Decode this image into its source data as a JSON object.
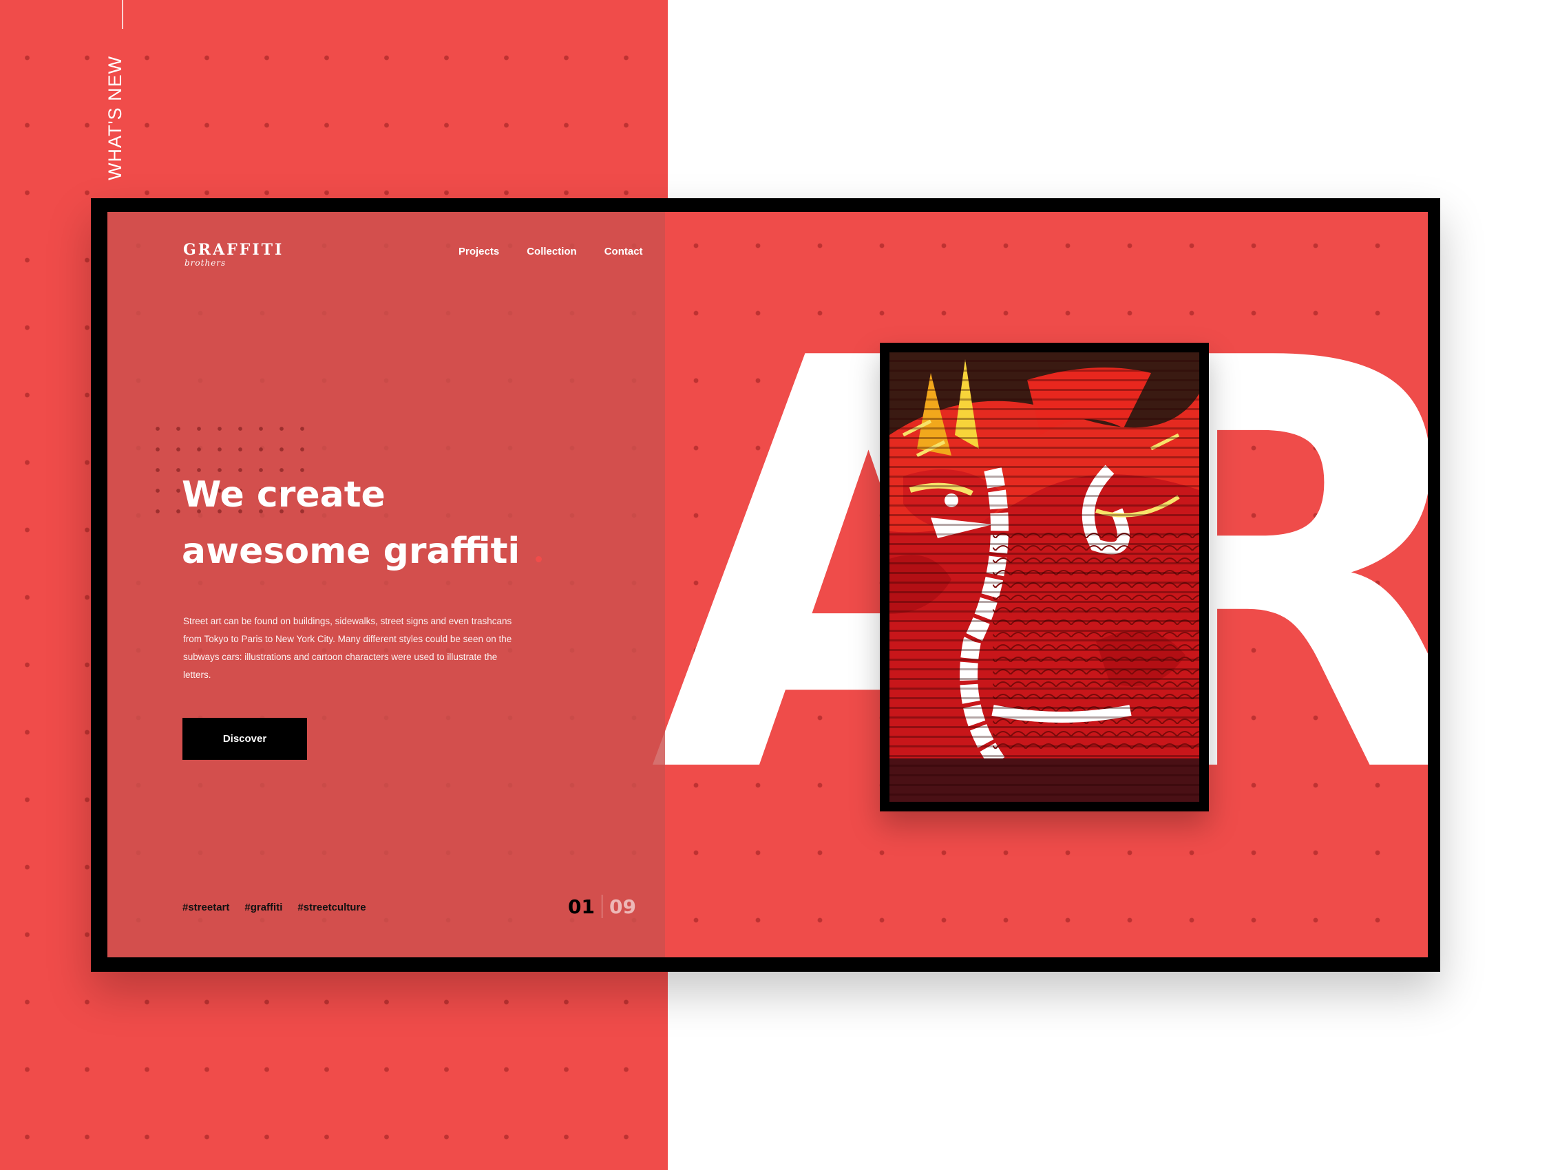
{
  "side": {
    "label": "WHAT'S NEW"
  },
  "logo": {
    "title": "GRAFFITI",
    "subtitle": "brothers"
  },
  "nav": [
    {
      "label": "Projects"
    },
    {
      "label": "Collection"
    },
    {
      "label": "Contact"
    }
  ],
  "hero": {
    "headline_line1": "We create",
    "headline_line2": "awesome graffiti",
    "description": "Street art can be found on buildings, sidewalks, street signs and even trashcans from Tokyo to Paris to New York City. Many different styles could be seen on the subways cars: illustrations and cartoon characters were used to illustrate the letters.",
    "cta_label": "Discover",
    "big_text": "ART"
  },
  "tags": [
    "#streetart",
    "#graffiti",
    "#streetculture"
  ],
  "pager": {
    "current": "01",
    "total": "09"
  },
  "colors": {
    "brand_red": "#f04c4a",
    "panel_red": "#cd504e",
    "black": "#000000"
  },
  "image": {
    "subject": "red-dragon-graffiti-on-shutter"
  }
}
